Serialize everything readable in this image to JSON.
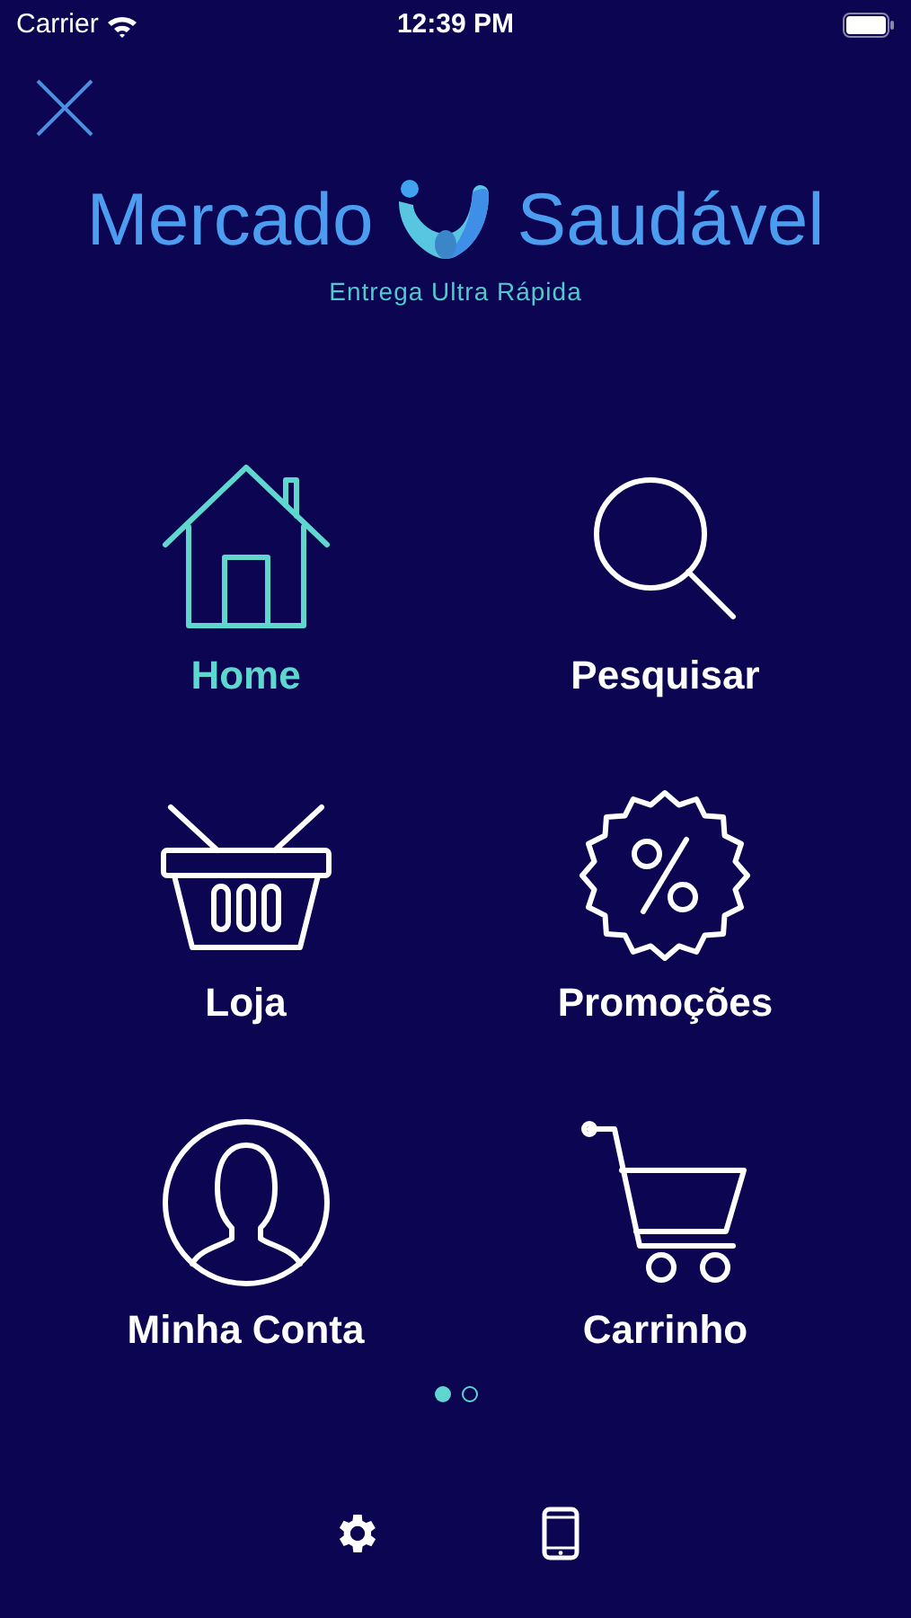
{
  "status_bar": {
    "carrier": "Carrier",
    "time": "12:39 PM"
  },
  "logo": {
    "left": "Mercado",
    "right": "Saudável",
    "tagline": "Entrega Ultra Rápida"
  },
  "menu": [
    {
      "kind": "home",
      "label": "Home",
      "selected": true
    },
    {
      "kind": "search",
      "label": "Pesquisar",
      "selected": false
    },
    {
      "kind": "basket",
      "label": "Loja",
      "selected": false
    },
    {
      "kind": "promo",
      "label": "Promoções",
      "selected": false
    },
    {
      "kind": "account",
      "label": "Minha Conta",
      "selected": false
    },
    {
      "kind": "cart",
      "label": "Carrinho",
      "selected": false
    }
  ],
  "pages": [
    {
      "selected": true
    },
    {
      "selected": false
    }
  ],
  "bottom_bar": [
    {
      "kind": "settings"
    },
    {
      "kind": "device"
    }
  ]
}
